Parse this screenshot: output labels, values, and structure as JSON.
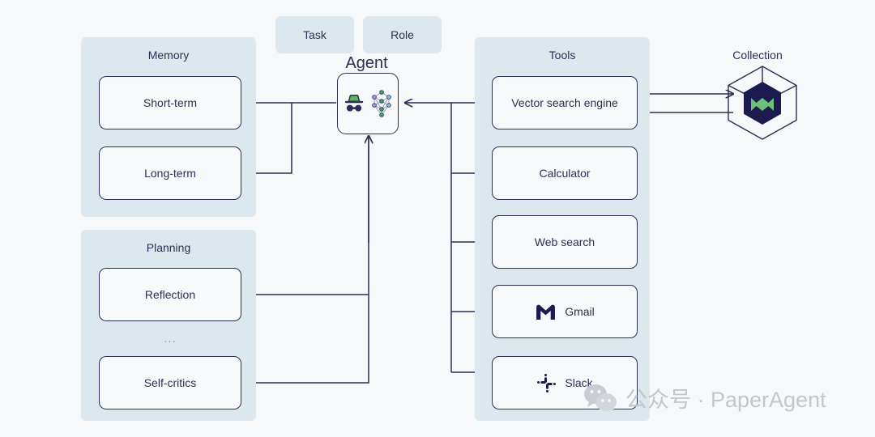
{
  "theme": {
    "page_bg": "#f7f8fa",
    "panel_bg": "#dce7ee",
    "node_bg": "#f8f9fb",
    "ink": "#2b2f54",
    "accent_green": "#5cb85c",
    "muted": "#8f97b5",
    "watermark": "#c3c6cd"
  },
  "chips": [
    {
      "label": "Task",
      "name": "chip-task"
    },
    {
      "label": "Role",
      "name": "chip-role"
    }
  ],
  "agent": {
    "caption": "Agent",
    "icon": "langchain-agent-icon"
  },
  "panels": {
    "memory": {
      "title": "Memory",
      "nodes": [
        {
          "label": "Short-term",
          "name": "node-short-term"
        },
        {
          "label": "Long-term",
          "name": "node-long-term"
        }
      ]
    },
    "planning": {
      "title": "Planning",
      "ellipsis": "...",
      "nodes": [
        {
          "label": "Reflection",
          "name": "node-reflection"
        },
        {
          "label": "Self-critics",
          "name": "node-self-critics"
        }
      ]
    },
    "tools": {
      "title": "Tools",
      "nodes": [
        {
          "label": "Vector search engine",
          "name": "node-vector-search-engine",
          "icon": null
        },
        {
          "label": "Calculator",
          "name": "node-calculator",
          "icon": null
        },
        {
          "label": "Web search",
          "name": "node-web-search",
          "icon": null
        },
        {
          "label": "Gmail",
          "name": "node-gmail",
          "icon": "gmail-icon"
        },
        {
          "label": "Slack",
          "name": "node-slack",
          "icon": "slack-icon"
        }
      ]
    }
  },
  "collection": {
    "caption": "Collection",
    "icon": "weaviate-hexagon-icon"
  },
  "watermark": {
    "icon": "wechat-icon",
    "text": "公众号 · PaperAgent"
  }
}
